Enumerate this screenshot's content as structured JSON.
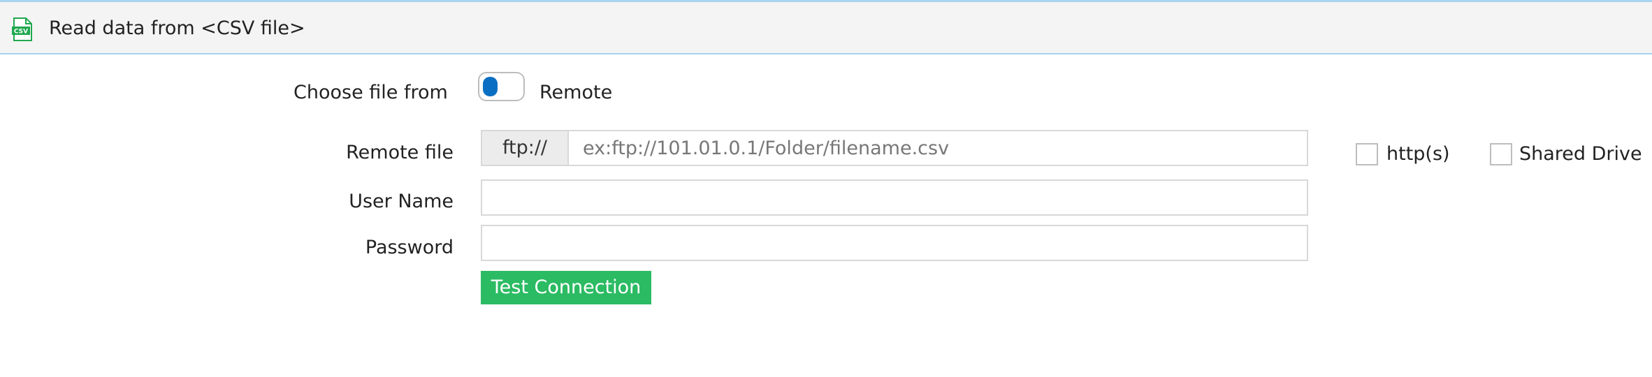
{
  "header": {
    "title": "Read data from <CSV file>",
    "icon": "csv-file-icon",
    "icon_text": "CSV",
    "accent_color": "#1fa84f"
  },
  "source": {
    "label": "Choose file from",
    "toggle_value": "Remote",
    "toggle_color": "#0a6fc2"
  },
  "remote_file": {
    "label": "Remote file",
    "prefix": "ftp://",
    "value": "",
    "placeholder": "ex:ftp://101.01.0.1/Folder/filename.csv"
  },
  "options": {
    "https_label": "http(s)",
    "https_checked": false,
    "shared_drive_label": "Shared Drive",
    "shared_drive_checked": false
  },
  "username": {
    "label": "User Name",
    "value": ""
  },
  "password": {
    "label": "Password",
    "value": ""
  },
  "actions": {
    "test_connection_label": "Test Connection",
    "test_connection_color": "#2bbb63"
  }
}
